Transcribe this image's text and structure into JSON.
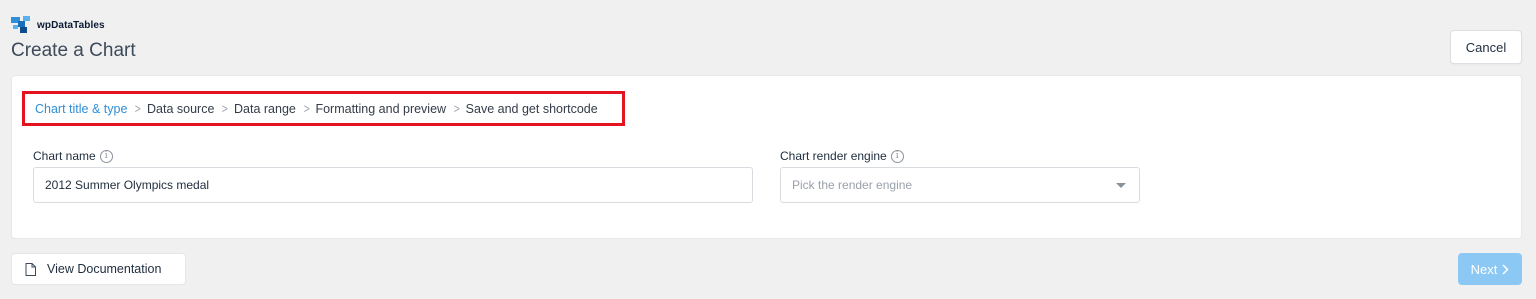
{
  "header": {
    "brand_name": "wpDataTables",
    "title": "Create a Chart",
    "cancel_label": "Cancel"
  },
  "steps": [
    {
      "label": "Chart title & type",
      "active": true
    },
    {
      "label": "Data source",
      "active": false
    },
    {
      "label": "Data range",
      "active": false
    },
    {
      "label": "Formatting and preview",
      "active": false
    },
    {
      "label": "Save and get shortcode",
      "active": false
    }
  ],
  "step_separator": ">",
  "form": {
    "chart_name": {
      "label": "Chart name",
      "value": "2012 Summer Olympics medal"
    },
    "render_engine": {
      "label": "Chart render engine",
      "placeholder": "Pick the render engine"
    },
    "info_glyph": "i"
  },
  "footer": {
    "doc_label": "View Documentation",
    "next_label": "Next"
  },
  "colors": {
    "accent": "#2f8fd8",
    "highlight_border": "#e3141f",
    "next_button": "#8cc8f4"
  },
  "icons": [
    "brand-logo-icon",
    "info-icon",
    "caret-down-icon",
    "document-icon",
    "chevron-right-icon"
  ]
}
